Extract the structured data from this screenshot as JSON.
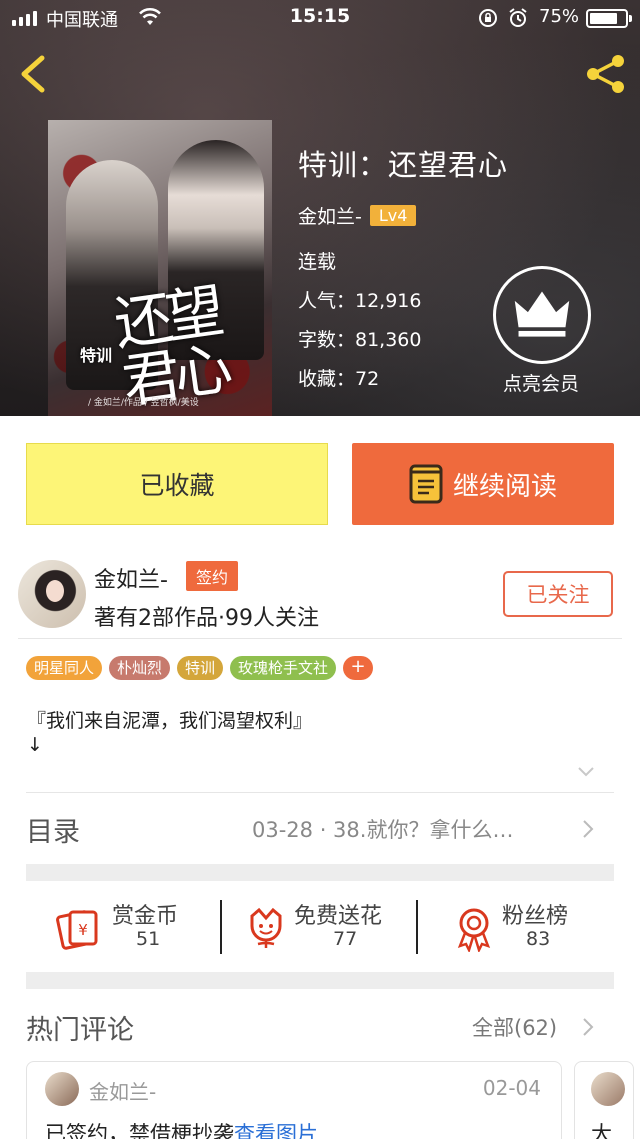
{
  "status_bar": {
    "carrier": "中国联通",
    "time": "15:15",
    "battery": "75%"
  },
  "book": {
    "cover": {
      "title_art": "还望君心",
      "subtitle_art": "特训",
      "credit": "/ 金如兰/作品 / 昱哲枫/美设"
    },
    "title": "特训：还望君心",
    "author": "金如兰-",
    "author_level": "Lv4",
    "status": "连载",
    "popularity": "人气：12,916",
    "word_count": "字数：81,360",
    "favorites": "收藏：72"
  },
  "member": {
    "label": "点亮会员"
  },
  "buttons": {
    "favorited": "已收藏",
    "continue_reading": "继续阅读"
  },
  "author_panel": {
    "name": "金如兰-",
    "badge": "签约",
    "stats": "著有2部作品·99人关注",
    "follow": "已关注"
  },
  "tags": [
    {
      "label": "明星同人",
      "color": "#f2a33a"
    },
    {
      "label": "朴灿烈",
      "color": "#c77a6d"
    },
    {
      "label": "特训",
      "color": "#d4a63b"
    },
    {
      "label": "玫瑰枪手文社",
      "color": "#8fbf4e"
    }
  ],
  "tag_add": "+",
  "summary": {
    "text": "『我们来自泥潭，我们渴望权利』",
    "arrow": "↓"
  },
  "toc": {
    "title": "目录",
    "latest": "03-28 · 38.就你？拿什么…"
  },
  "actions": [
    {
      "label": "赏金币",
      "count": "51",
      "icon": "red-envelope-icon"
    },
    {
      "label": "免费送花",
      "count": "77",
      "icon": "flower-icon"
    },
    {
      "label": "粉丝榜",
      "count": "83",
      "icon": "rosette-icon"
    }
  ],
  "comments": {
    "title": "热门评论",
    "all": "全部(62)",
    "items": [
      {
        "user": "金如兰-",
        "date": "02-04",
        "text": "已签约，禁借梗抄袭",
        "link": "查看图片"
      },
      {
        "text": "大"
      }
    ]
  },
  "colors": {
    "accent": "#ef6a3d",
    "favorite_bg": "#fdf577",
    "level_badge": "#f2b13a"
  }
}
